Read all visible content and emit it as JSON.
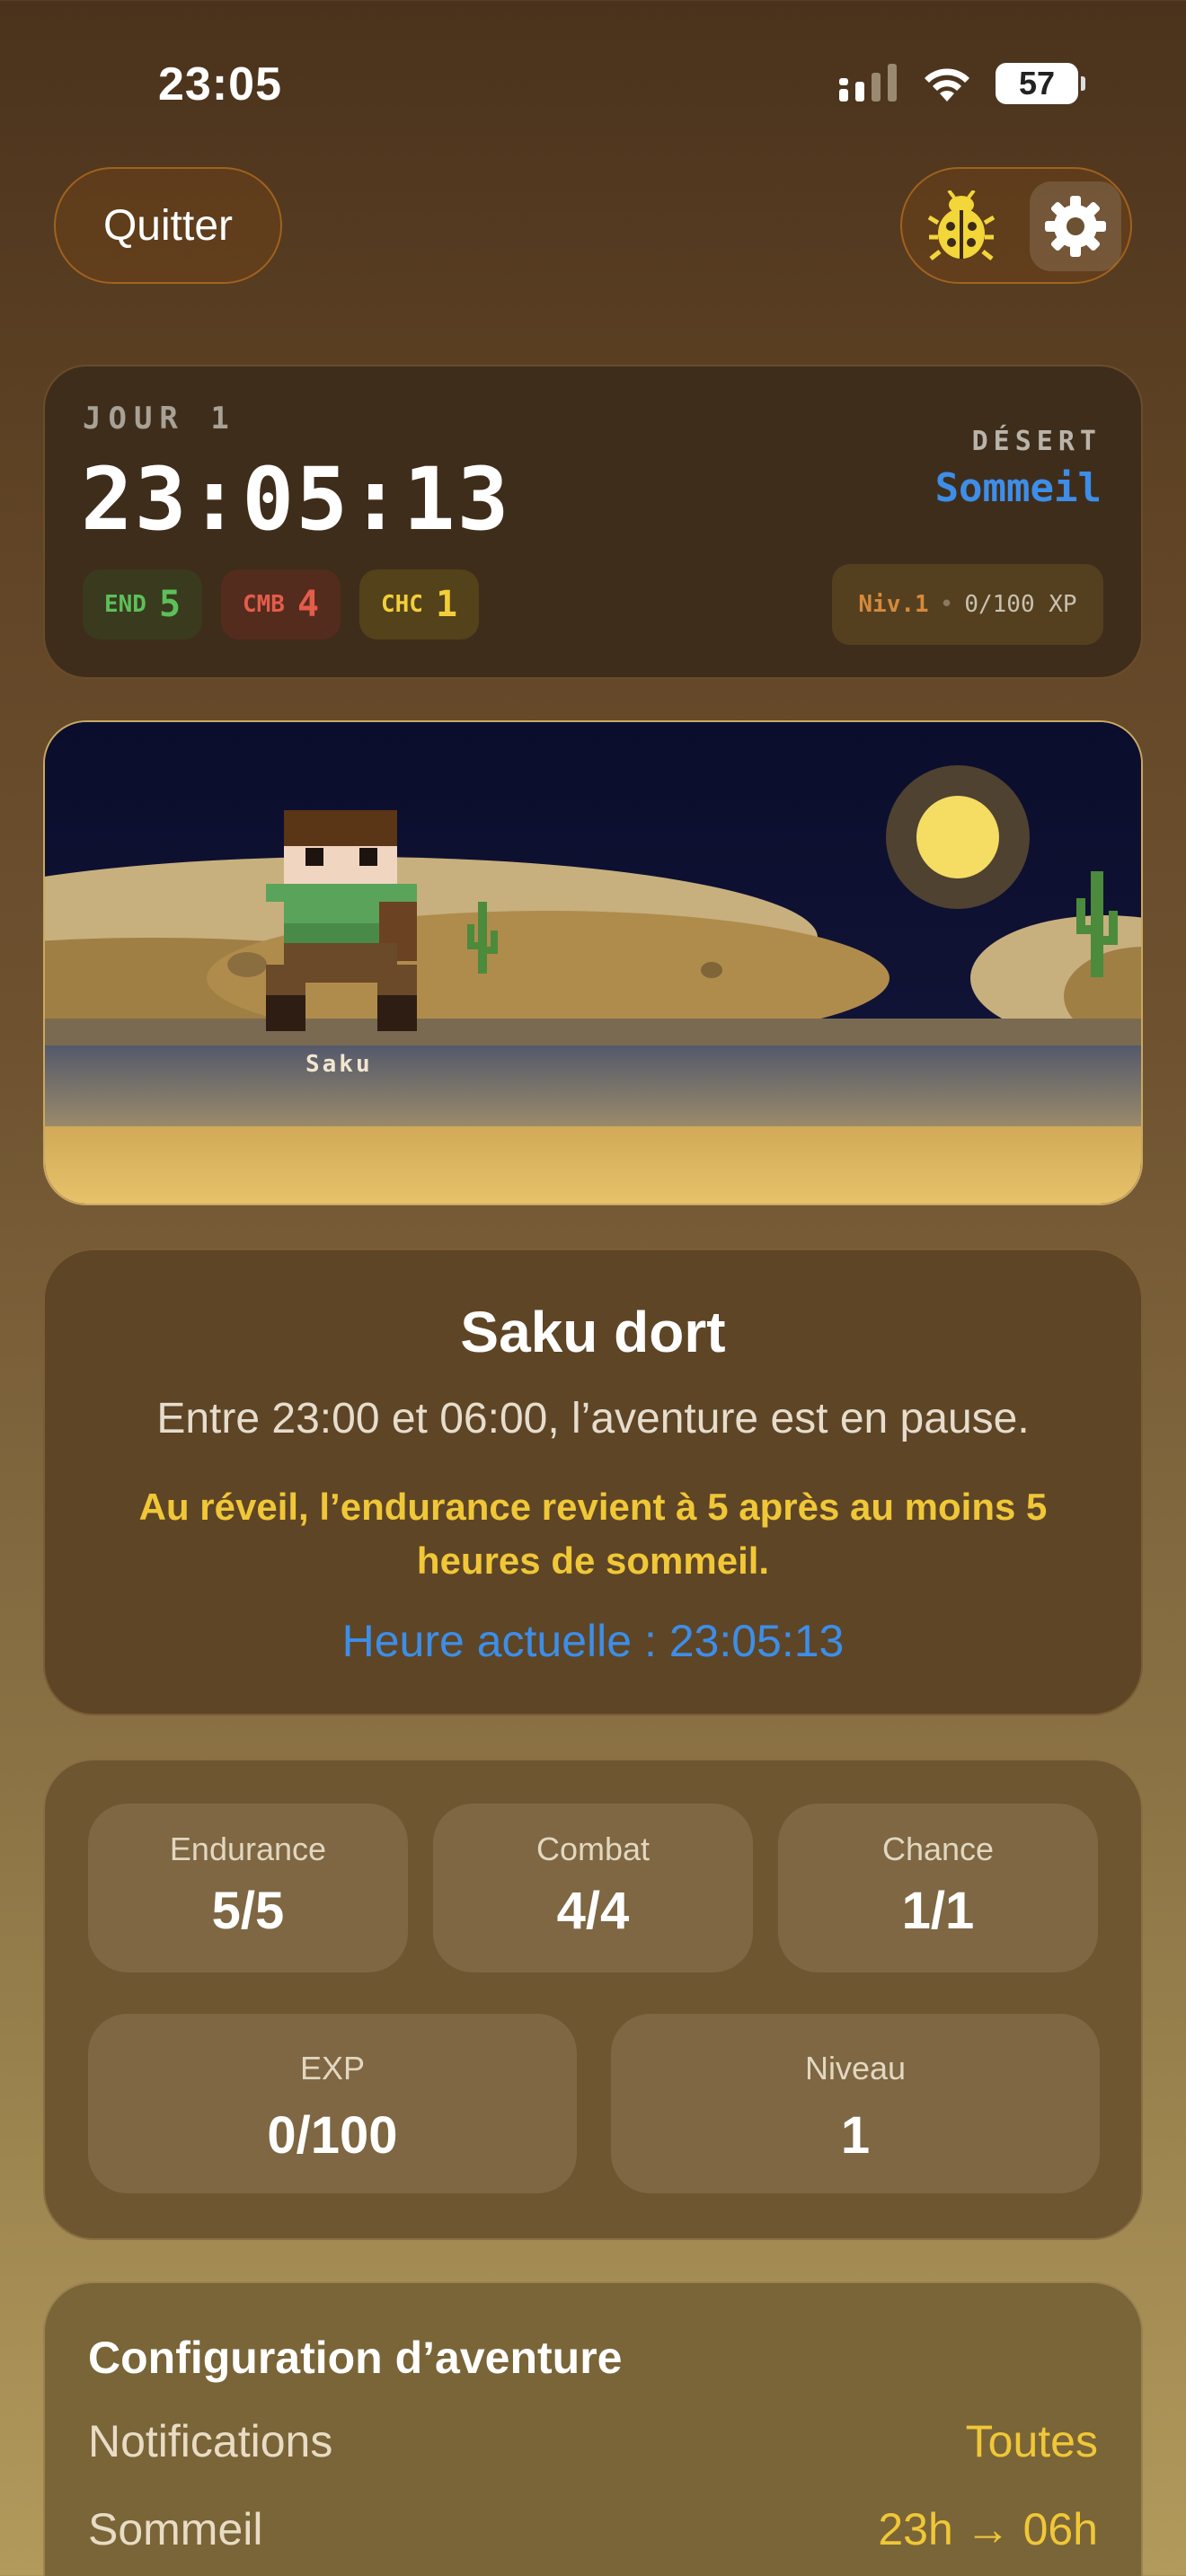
{
  "status_bar": {
    "time": "23:05",
    "battery": "57"
  },
  "top_bar": {
    "quit_label": "Quitter",
    "debug_icon": "bug-icon",
    "settings_icon": "gear-icon"
  },
  "hud": {
    "day_label": "JOUR 1",
    "clock": "23:05:13",
    "zone": "DÉSERT",
    "phase": "Sommeil",
    "stats": [
      {
        "key": "END",
        "value": "5",
        "color": "#5cc059"
      },
      {
        "key": "CMB",
        "value": "4",
        "color": "#e45c4a"
      },
      {
        "key": "CHC",
        "value": "1",
        "color": "#f2cf3a"
      }
    ],
    "level": "Niv.1",
    "separator": "•",
    "xp": "0/100 XP"
  },
  "scene": {
    "character_name": "Saku"
  },
  "sleep_card": {
    "title": "Saku dort",
    "message": "Entre 23:00 et 06:00, l’aventure est en pause.",
    "warning": "Au réveil, l’endurance revient à 5 après au moins 5 heures de sommeil.",
    "current_time": "Heure actuelle : 23:05:13"
  },
  "stats_card": {
    "tiles": [
      {
        "label": "Endurance",
        "value": "5/5"
      },
      {
        "label": "Combat",
        "value": "4/4"
      },
      {
        "label": "Chance",
        "value": "1/1"
      },
      {
        "label": "EXP",
        "value": "0/100"
      },
      {
        "label": "Niveau",
        "value": "1"
      }
    ]
  },
  "config_card": {
    "title": "Configuration d’aventure",
    "rows": [
      {
        "label": "Notifications",
        "value": "Toutes"
      },
      {
        "label": "Sommeil",
        "value": "23h → 06h"
      }
    ]
  },
  "colors": {
    "accent_blue": "#3d8ee8",
    "accent_yellow": "#f0c737",
    "button_border": "#a0621e"
  }
}
